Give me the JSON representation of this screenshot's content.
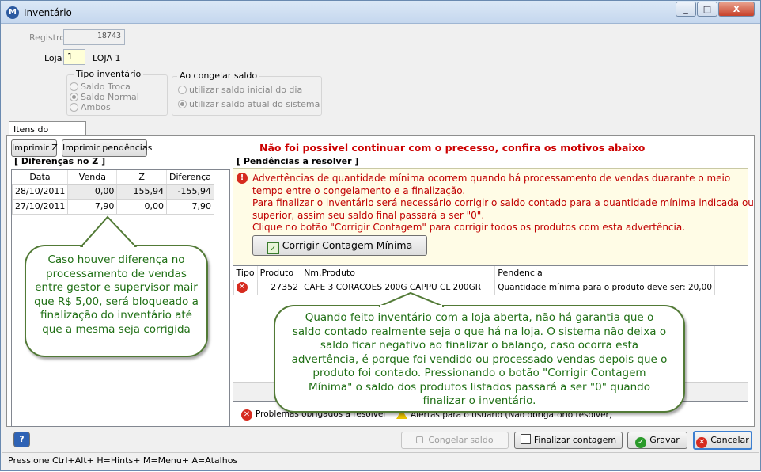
{
  "window": {
    "title": "Inventário",
    "min": "_",
    "max": "□",
    "close": "X"
  },
  "form": {
    "registro_label": "Registro",
    "registro_value": "18743",
    "loja_label": "Loja",
    "loja_value": "1",
    "loja_name": "LOJA 1"
  },
  "tipo_inventario": {
    "title": "Tipo inventário",
    "options": [
      {
        "label": "Saldo Troca",
        "selected": false
      },
      {
        "label": "Saldo Normal",
        "selected": true
      },
      {
        "label": "Ambos",
        "selected": false
      }
    ]
  },
  "congelar": {
    "title": "Ao congelar saldo",
    "options": [
      {
        "label": "utilizar saldo inicial do dia",
        "selected": false
      },
      {
        "label": "utilizar saldo atual do sistema",
        "selected": true
      }
    ]
  },
  "tab": {
    "label": "Itens do inventário"
  },
  "toolbar": {
    "imprimir_z": "Imprimir Z",
    "imprimir_pendencias": "Imprimir pendências"
  },
  "message": "Não foi possivel continuar com o precesso, confira os motivos abaixo",
  "diferencas": {
    "title": "[ Diferenças no Z ]",
    "columns": [
      "Data",
      "Venda",
      "Z",
      "Diferença"
    ],
    "rows": [
      [
        "28/10/2011",
        "0,00",
        "155,94",
        "-155,94"
      ],
      [
        "27/10/2011",
        "7,90",
        "0,00",
        "7,90"
      ]
    ]
  },
  "pendencias": {
    "title": "[ Pendências a resolver ]",
    "warning_lines": [
      "Advertências de quantidade mínima ocorrem quando há processamento de vendas duarante o meio",
      "tempo entre o congelamento e a finalização.",
      "Para finalizar o inventário será necessário corrigir o saldo contado para a quantidade mínima indicada ou",
      "superior, assim seu saldo final passará a ser \"0\".",
      "Clique no botão \"Corrigir Contagem\" para corrigir todos os produtos com esta advertência."
    ],
    "corrigir_button": "Corrigir Contagem Mínima",
    "columns": [
      "Tipo",
      "Produto",
      "Nm.Produto",
      "Pendencia"
    ],
    "rows": [
      {
        "produto": "27352",
        "nome": "CAFE 3 CORACOES 200G CAPPU CL 200GR",
        "pendencia": "Quantidade mínima para o produto deve ser: 20,00"
      }
    ]
  },
  "legend": {
    "problemas": "Problemas obrigados a resolver",
    "alertas": "Alertas para o usuário (Não obrigatório resolver)"
  },
  "callouts": {
    "left": "Caso houver diferença no processamento de vendas entre gestor e supervisor mair que R$ 5,00, será bloqueado a finalização do inventário até que a mesma seja corrigida",
    "right": "Quando feito inventário com a loja aberta, não há garantia que o saldo contado realmente seja o que há na loja. O sistema não deixa o saldo ficar negativo ao finalizar o balanço, caso ocorra esta advertência, é porque foi vendido ou processado vendas depois que o produto foi contado. Pressionando o botão \"Corrigir Contagem Mínima\" o saldo dos produtos listados passará a ser \"0\" quando finalizar o inventário."
  },
  "buttons": {
    "help": "?",
    "congelar": "Congelar saldo",
    "finalizar": "Finalizar contagem",
    "gravar": "Gravar",
    "cancelar": "Cancelar"
  },
  "status": "Pressione Ctrl+Alt+ H=Hints+ M=Menu+ A=Atalhos"
}
